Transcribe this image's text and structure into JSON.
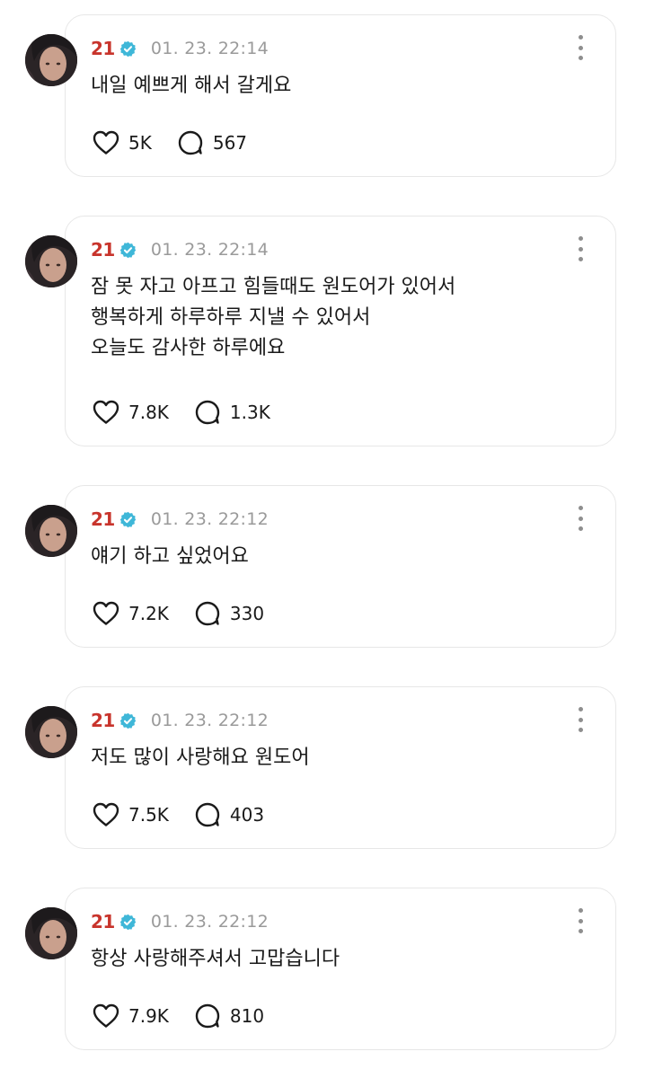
{
  "posts": [
    {
      "author": "21",
      "timestamp": "01. 23. 22:14",
      "text": "내일 예쁘게 해서 갈게요",
      "likes": "5K",
      "replies": "567",
      "icons": {
        "like": "heart-icon",
        "reply": "speech-bubble-icon",
        "verified": "verified-badge-icon",
        "more": "more-vertical-icon"
      }
    },
    {
      "author": "21",
      "timestamp": "01. 23. 22:14",
      "text": "잠 못 자고 아프고 힘들때도 원도어가 있어서\n행복하게 하루하루 지낼 수 있어서\n오늘도 감사한 하루에요",
      "likes": "7.8K",
      "replies": "1.3K",
      "icons": {
        "like": "heart-icon",
        "reply": "speech-bubble-icon",
        "verified": "verified-badge-icon",
        "more": "more-vertical-icon"
      }
    },
    {
      "author": "21",
      "timestamp": "01. 23. 22:12",
      "text": "얘기 하고 싶었어요",
      "likes": "7.2K",
      "replies": "330",
      "icons": {
        "like": "heart-icon",
        "reply": "speech-bubble-icon",
        "verified": "verified-badge-icon",
        "more": "more-vertical-icon"
      }
    },
    {
      "author": "21",
      "timestamp": "01. 23. 22:12",
      "text": "저도 많이 사랑해요 원도어",
      "likes": "7.5K",
      "replies": "403",
      "icons": {
        "like": "heart-icon",
        "reply": "speech-bubble-icon",
        "verified": "verified-badge-icon",
        "more": "more-vertical-icon"
      }
    },
    {
      "author": "21",
      "timestamp": "01. 23. 22:12",
      "text": "항상 사랑해주셔서 고맙습니다",
      "likes": "7.9K",
      "replies": "810",
      "icons": {
        "like": "heart-icon",
        "reply": "speech-bubble-icon",
        "verified": "verified-badge-icon",
        "more": "more-vertical-icon"
      }
    }
  ],
  "colors": {
    "author": "#c8342c",
    "verified": "#3fb7d8",
    "timestamp": "#9a9a9a",
    "text": "#1a1a1a",
    "border": "#e7e7e7"
  }
}
